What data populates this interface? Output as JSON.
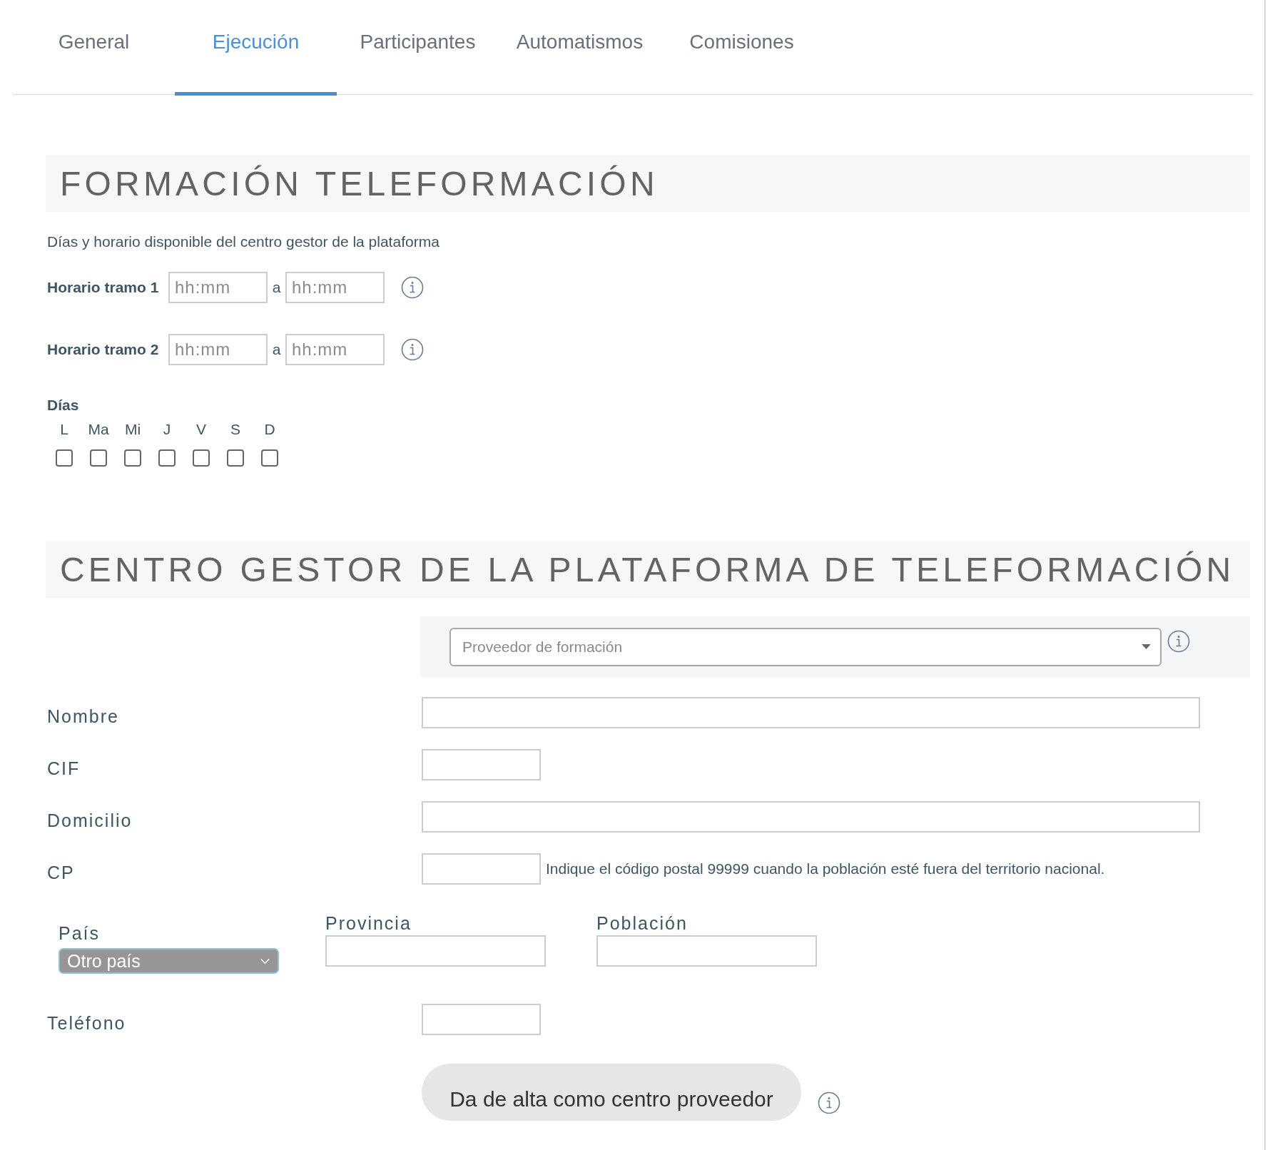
{
  "tabs": [
    {
      "label": "General",
      "selected": false
    },
    {
      "label": "Ejecución",
      "selected": true
    },
    {
      "label": "Participantes",
      "selected": false
    },
    {
      "label": "Automatismos",
      "selected": false
    },
    {
      "label": "Comisiones",
      "selected": false
    }
  ],
  "schedule_section": {
    "title": "FORMACIÓN TELEFORMACIÓN",
    "description": "Días y horario disponible del centro gestor de la plataforma",
    "time_slots": [
      {
        "label": "Horario tramo 1",
        "separator": "a",
        "from_placeholder": "hh:mm",
        "to_placeholder": "hh:mm"
      },
      {
        "label": "Horario tramo 2",
        "separator": "a",
        "from_placeholder": "hh:mm",
        "to_placeholder": "hh:mm"
      }
    ],
    "days_label": "Días",
    "days": [
      {
        "label": "L",
        "checked": false
      },
      {
        "label": "Ma",
        "checked": false
      },
      {
        "label": "Mi",
        "checked": false
      },
      {
        "label": "J",
        "checked": false
      },
      {
        "label": "V",
        "checked": false
      },
      {
        "label": "S",
        "checked": false
      },
      {
        "label": "D",
        "checked": false
      }
    ]
  },
  "center_section": {
    "title": "CENTRO GESTOR DE LA PLATAFORMA DE TELEFORMACIÓN",
    "provider_select": {
      "placeholder": "Proveedor de formación"
    },
    "fields": [
      {
        "label": "Nombre",
        "kind": "wide"
      },
      {
        "label": "CIF",
        "kind": "short"
      },
      {
        "label": "Domicilio",
        "kind": "wide"
      },
      {
        "label": "CP",
        "kind": "short",
        "hint": "Indique el código postal 99999 cuando la población esté fuera del territorio nacional."
      }
    ],
    "location": [
      {
        "label": "País",
        "kind": "select",
        "value": "Otro país"
      },
      {
        "label": "Provincia",
        "kind": "text"
      },
      {
        "label": "Población",
        "kind": "text"
      }
    ],
    "phone": {
      "label": "Teléfono"
    },
    "submit_button": {
      "label": "Da de alta como centro proveedor"
    }
  }
}
